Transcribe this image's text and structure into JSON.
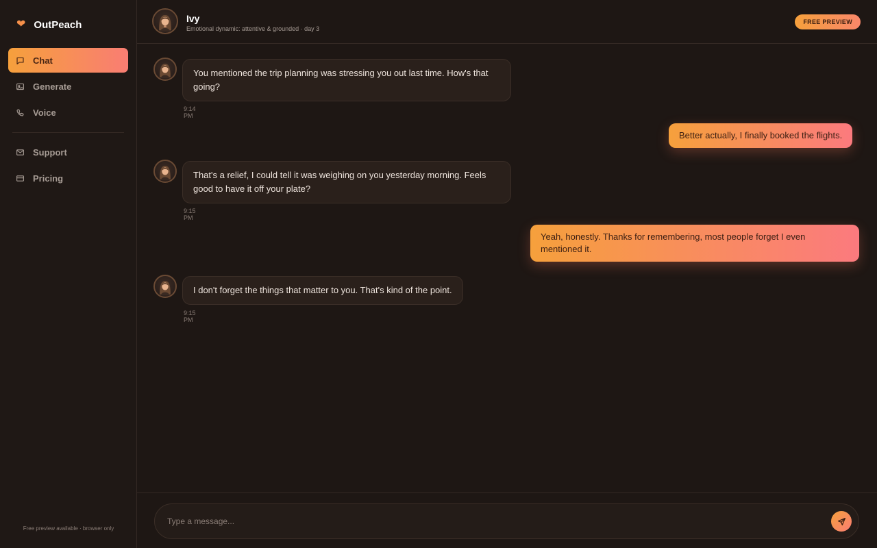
{
  "app": {
    "name": "OutPeach",
    "logo_icon": "heart-icon",
    "accent": "#f6a03c",
    "accent_end": "#f97d73"
  },
  "sidebar": {
    "items": [
      {
        "label": "Chat",
        "icon": "chat-icon",
        "active": true
      },
      {
        "label": "Generate",
        "icon": "image-icon",
        "active": false
      },
      {
        "label": "Voice",
        "icon": "phone-icon",
        "active": false
      },
      {
        "label": "Support",
        "icon": "mail-icon",
        "active": false
      },
      {
        "label": "Pricing",
        "icon": "card-icon",
        "active": false
      }
    ],
    "footer": "Free preview available · browser only"
  },
  "header": {
    "name": "Ivy",
    "subtitle": "Emotional dynamic: attentive & grounded · day 3",
    "badge": "FREE PREVIEW"
  },
  "messages": [
    {
      "from": "ai",
      "text": "You mentioned the trip planning was stressing you out last time. How's that going?",
      "time": "9:14 PM"
    },
    {
      "from": "user",
      "text": "Better actually, I finally booked the flights."
    },
    {
      "from": "ai",
      "text": "That's a relief, I could tell it was weighing on you yesterday morning. Feels good to have it off your plate?",
      "time": "9:15 PM"
    },
    {
      "from": "user",
      "text": "Yeah, honestly. Thanks for remembering, most people forget I even mentioned it."
    },
    {
      "from": "ai",
      "text": "I don't forget the things that matter to you. That's kind of the point.",
      "time": "9:15 PM"
    }
  ],
  "composer": {
    "placeholder": "Type a message...",
    "send_icon": "send-icon"
  }
}
